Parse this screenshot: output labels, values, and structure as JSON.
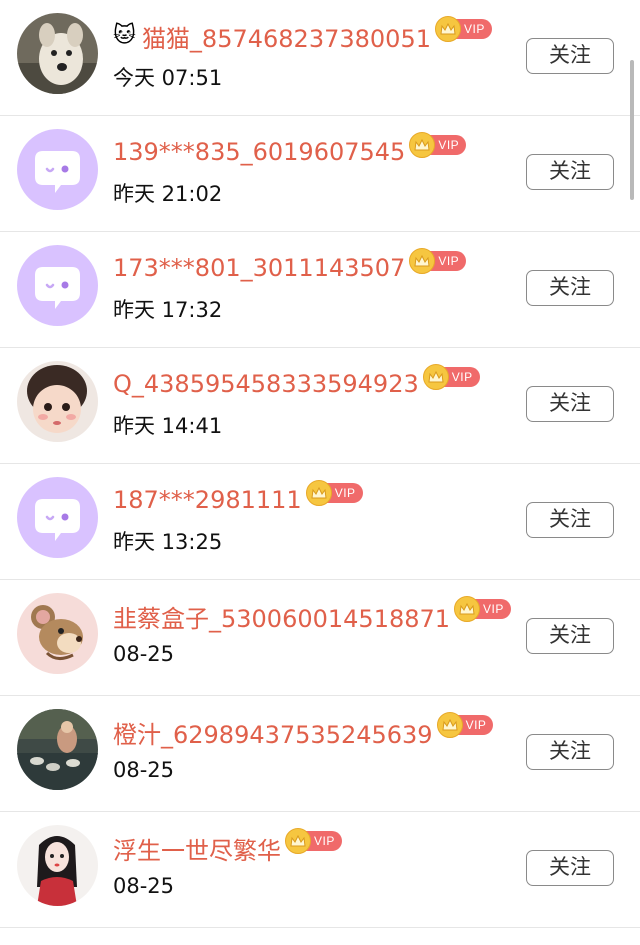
{
  "follow_label": "关注",
  "vip_label": "VIP",
  "users": [
    {
      "emoji": "🐱",
      "name": "猫猫_857468237380051",
      "time": "今天 07:51",
      "avatar": "dog-photo"
    },
    {
      "emoji": "",
      "name": "139***835_6019607545",
      "time": "昨天 21:02",
      "avatar": "default-chat"
    },
    {
      "emoji": "",
      "name": "173***801_3011143507",
      "time": "昨天 17:32",
      "avatar": "default-chat"
    },
    {
      "emoji": "",
      "name": "Q_438595458333594923",
      "time": "昨天 14:41",
      "avatar": "child-photo"
    },
    {
      "emoji": "",
      "name": "187***2981111",
      "time": "昨天 13:25",
      "avatar": "default-chat"
    },
    {
      "emoji": "",
      "name": "韭蔡盒子_530060014518871",
      "time": "08-25",
      "avatar": "cartoon-mouse"
    },
    {
      "emoji": "",
      "name": "橙汁_62989437535245639",
      "time": "08-25",
      "avatar": "ducks-photo"
    },
    {
      "emoji": "",
      "name": "浮生一世尽繁华",
      "time": "08-25",
      "avatar": "girl-illustration"
    }
  ],
  "colors": {
    "name": "#e0604a",
    "vip_badge": "#f06a6a",
    "crown": "#f6c640",
    "default_avatar_bg": "#d9c2ff"
  }
}
